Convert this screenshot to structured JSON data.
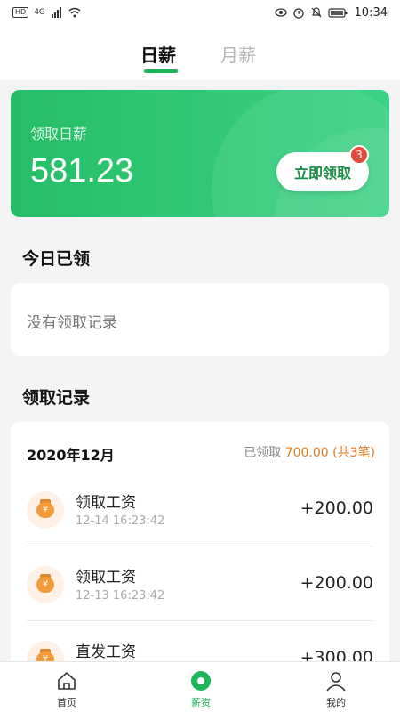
{
  "status_bar": {
    "left_hd": "HD",
    "left_signal": "4G",
    "time": "10:34"
  },
  "tabs": [
    {
      "label": "日薪",
      "active": true
    },
    {
      "label": "月薪",
      "active": false
    }
  ],
  "daily_card": {
    "label": "领取日薪",
    "amount": "581.23",
    "button_label": "立即领取",
    "badge_count": "3"
  },
  "today_section": {
    "title": "今日已领",
    "empty_text": "没有领取记录"
  },
  "records_section": {
    "title": "领取记录",
    "month": "2020年12月",
    "summary_prefix": "已领取",
    "summary_amount": "700.00",
    "summary_count": "(共3笔)",
    "items": [
      {
        "title": "领取工资",
        "time": "12-14 16:23:42",
        "amount": "+200.00"
      },
      {
        "title": "领取工资",
        "time": "12-13 16:23:42",
        "amount": "+200.00"
      },
      {
        "title": "直发工资",
        "time": "",
        "amount": "+300.00"
      }
    ]
  },
  "bottom_nav": [
    {
      "label": "首页",
      "icon": "home-icon"
    },
    {
      "label": "薪资",
      "icon": "salary-icon"
    },
    {
      "label": "我的",
      "icon": "user-icon"
    }
  ],
  "colors": {
    "accent": "#1fb65a",
    "orange": "#e07b1f",
    "badge": "#e24b3b"
  }
}
